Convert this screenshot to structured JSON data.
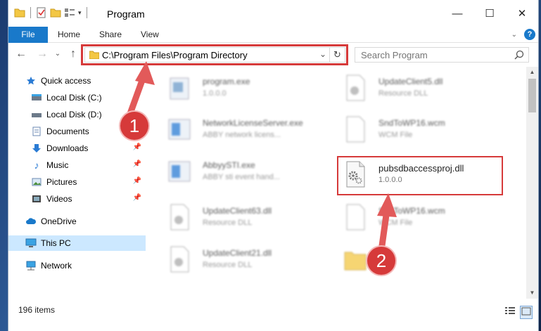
{
  "window": {
    "title": "Program"
  },
  "ribbon": {
    "tabs": [
      "File",
      "Home",
      "Share",
      "View"
    ]
  },
  "address": {
    "path": "C:\\Program Files\\Program Directory"
  },
  "search": {
    "placeholder": "Search Program"
  },
  "nav": [
    {
      "label": "Quick access",
      "icon": "star-icon"
    },
    {
      "label": "Local Disk (C:)",
      "icon": "drive-icon"
    },
    {
      "label": "Local Disk (D:)",
      "icon": "drive-icon"
    },
    {
      "label": "Documents",
      "icon": "documents-icon",
      "pinned": true
    },
    {
      "label": "Downloads",
      "icon": "downloads-icon",
      "pinned": true
    },
    {
      "label": "Music",
      "icon": "music-icon",
      "pinned": true
    },
    {
      "label": "Pictures",
      "icon": "pictures-icon",
      "pinned": true
    },
    {
      "label": "Videos",
      "icon": "videos-icon",
      "pinned": true
    },
    {
      "label": "OneDrive",
      "icon": "cloud-icon"
    },
    {
      "label": "This PC",
      "icon": "computer-icon"
    },
    {
      "label": "Network",
      "icon": "network-icon"
    }
  ],
  "files": [
    {
      "name": "program.exe",
      "desc": "1.0.0.0"
    },
    {
      "name": "UpdateClient5.dll",
      "desc": "Resource DLL"
    },
    {
      "name": "NetworkLicenseServer.exe",
      "desc": "ABBY network licens..."
    },
    {
      "name": "SndToWP16.wcm",
      "desc": "WCM File"
    },
    {
      "name": "AbbyySTI.exe",
      "desc": "ABBY sti event hand..."
    },
    {
      "name": "pubsdbaccessproj.dll",
      "desc": "1.0.0.0"
    },
    {
      "name": "UpdateClient63.dll",
      "desc": "Resource DLL"
    },
    {
      "name": "SndToWP16.wcm",
      "desc": "WCM File"
    },
    {
      "name": "UpdateClient21.dll",
      "desc": "Resource DLL"
    }
  ],
  "status": {
    "count": "196 items"
  },
  "annotations": {
    "step1": "1",
    "step2": "2"
  },
  "colors": {
    "accent": "#1979ca",
    "highlight": "#d63a3a",
    "selected": "#cce8ff"
  }
}
